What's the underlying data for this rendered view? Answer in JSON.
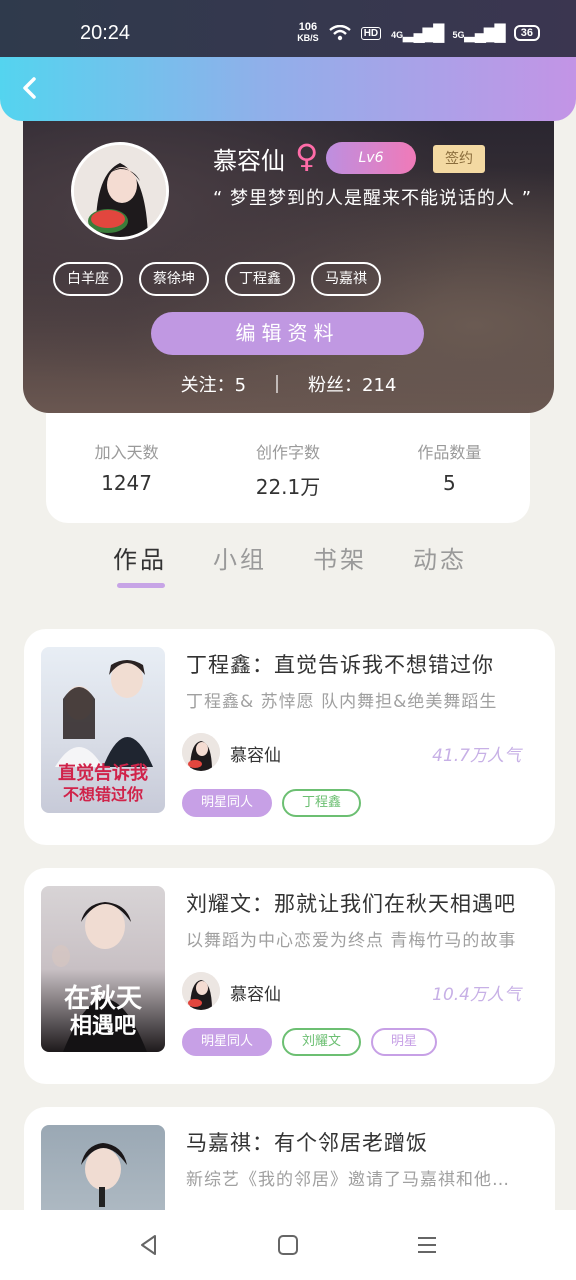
{
  "status_bar": {
    "time": "20:24",
    "speed_value": "106",
    "speed_unit": "KB/S",
    "hd": "HD",
    "net1": "4G",
    "net2": "5G",
    "battery": "36"
  },
  "profile": {
    "username": "慕容仙",
    "gender": "♀",
    "level": "Lv6",
    "signed": "签约",
    "motto": "“ 梦里梦到的人是醒来不能说话的人 ”",
    "tags": [
      "白羊座",
      "蔡徐坤",
      "丁程鑫",
      "马嘉祺"
    ],
    "edit_label": "编辑资料",
    "follow_label": "关注：5",
    "fans_label": "粉丝：214"
  },
  "stats": [
    {
      "label": "加入天数",
      "value": "1247"
    },
    {
      "label": "创作字数",
      "value": "22.1万"
    },
    {
      "label": "作品数量",
      "value": "5"
    }
  ],
  "tabs": [
    "作品",
    "小组",
    "书架",
    "动态"
  ],
  "works": [
    {
      "title": "丁程鑫：直觉告诉我不想错过你",
      "summary": "丁程鑫& 苏悻愿 队内舞担&绝美舞蹈生",
      "author": "慕容仙",
      "popularity": "41.7万人气",
      "cover_line1": "直觉告诉我",
      "cover_line2": "不想错过你",
      "tags": [
        "明星同人",
        "丁程鑫"
      ]
    },
    {
      "title": "刘耀文：那就让我们在秋天相遇吧",
      "summary": "以舞蹈为中心恋爱为终点 青梅竹马的故事",
      "author": "慕容仙",
      "popularity": "10.4万人气",
      "cover_line1": "在秋天",
      "cover_line2": "相遇吧",
      "tags": [
        "明星同人",
        "刘耀文",
        "明星"
      ]
    },
    {
      "title": "马嘉祺：有个邻居老蹭饭",
      "summary": "新综艺《我的邻居》邀请了马嘉祺和他的邻居"
    }
  ],
  "colors": {
    "accent": "#c7a0e6",
    "header_start": "#54d4ef",
    "header_end": "#c394e6",
    "tag_green": "#6cbf72"
  },
  "icons": [
    "back-icon",
    "wifi-icon",
    "signal-icon",
    "battery-icon",
    "nav-back-icon",
    "nav-home-icon",
    "nav-menu-icon"
  ]
}
